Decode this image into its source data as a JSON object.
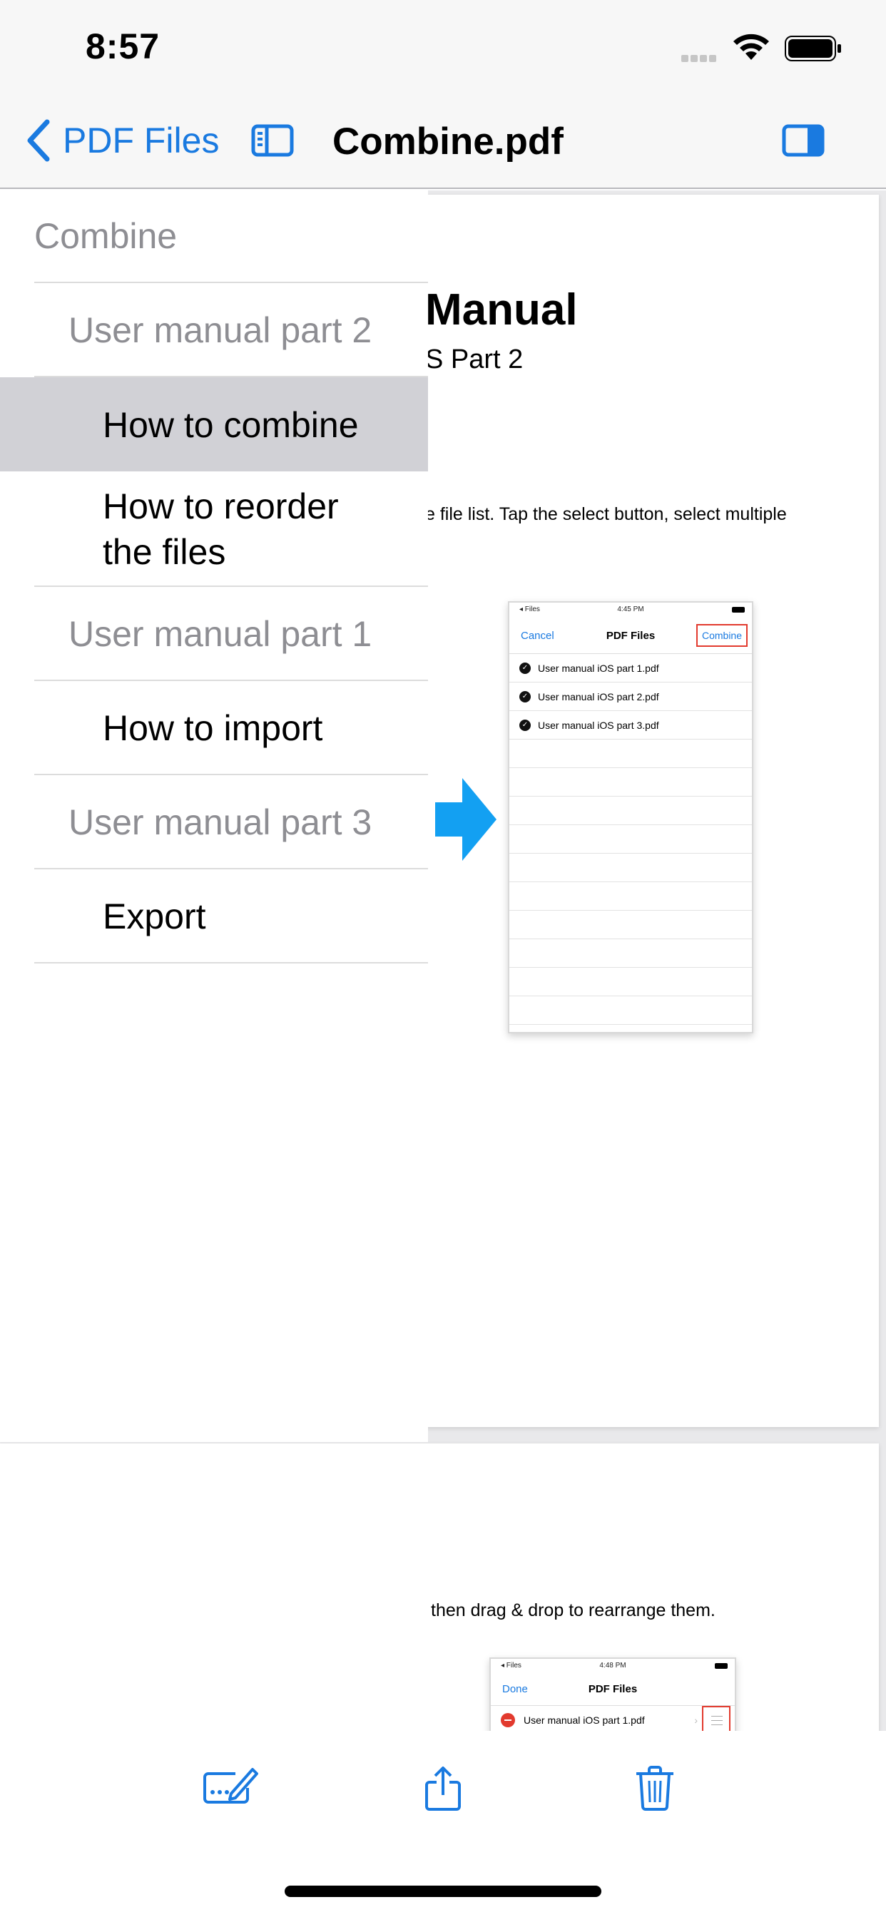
{
  "status_bar": {
    "time": "8:57"
  },
  "nav_bar": {
    "back_label": "PDF Files",
    "title": "Combine.pdf"
  },
  "outline": {
    "items": [
      {
        "label": "Combine",
        "level": 0
      },
      {
        "label": "User manual part 2",
        "level": 1
      },
      {
        "label": "How to combine",
        "level": 2,
        "selected": true
      },
      {
        "label": "How to reorder the files",
        "level": 2
      },
      {
        "label": "User manual part 1",
        "level": 1
      },
      {
        "label": "How to import",
        "level": 2
      },
      {
        "label": "User manual part 3",
        "level": 1
      },
      {
        "label": "Export",
        "level": 2
      }
    ]
  },
  "document": {
    "page1": {
      "heading": "Manual",
      "subheading": "S Part 2",
      "body": "e file list. Tap the select button, select multiple",
      "screenshot": {
        "status_left": "◂ Files",
        "status_time": "4:45 PM",
        "cancel": "Cancel",
        "title": "PDF Files",
        "combine": "Combine",
        "files": [
          "User manual iOS part 1.pdf",
          "User manual iOS part 2.pdf",
          "User manual iOS part 3.pdf"
        ]
      }
    },
    "page2": {
      "body": "then drag & drop to rearrange them.",
      "screenshot": {
        "status_left": "◂ Files",
        "status_time": "4:48 PM",
        "done": "Done",
        "title": "PDF Files",
        "file": "User manual iOS part 1.pdf"
      }
    }
  },
  "toolbar": {
    "icons": [
      "annotate-icon",
      "share-icon",
      "trash-icon"
    ]
  },
  "colors": {
    "accent": "#1a7ae0",
    "arrow": "#13a0f2",
    "highlight": "#e23a2e",
    "selection": "#d1d1d6"
  }
}
